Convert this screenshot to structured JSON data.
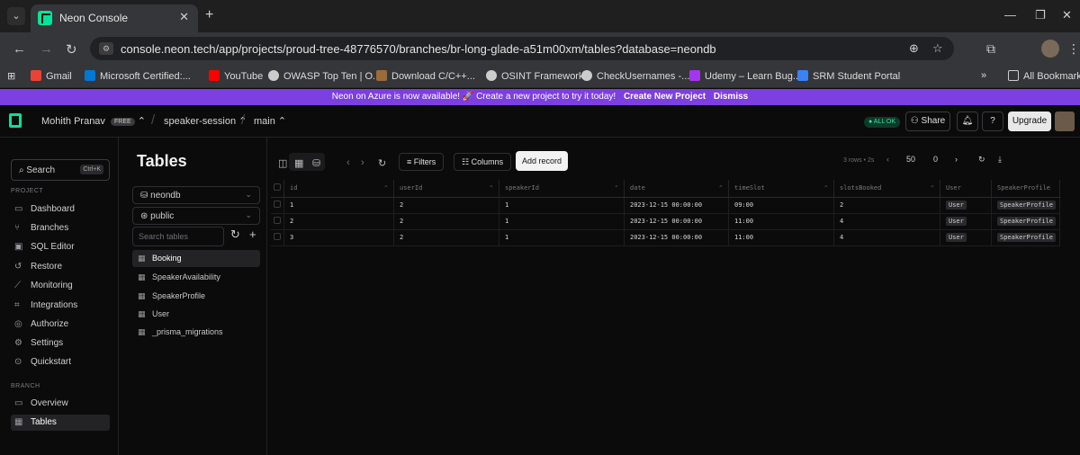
{
  "browser": {
    "tab_title": "Neon Console",
    "url": "console.neon.tech/app/projects/proud-tree-48776570/branches/br-long-glade-a51m00xm/tables?database=neondb",
    "bookmarks": [
      {
        "label": "Gmail",
        "color": "#ea4335"
      },
      {
        "label": "Microsoft Certified:...",
        "color": "#0078d4"
      },
      {
        "label": "YouTube",
        "color": "#ff0000"
      },
      {
        "label": "OWASP Top Ten | O...",
        "color": "#cccccc"
      },
      {
        "label": "Download C/C++...",
        "color": "#9b6b3a"
      },
      {
        "label": "OSINT Framework",
        "color": "#cccccc"
      },
      {
        "label": "CheckUsernames -...",
        "color": "#cccccc"
      },
      {
        "label": "Udemy – Learn Bug...",
        "color": "#a435f0"
      },
      {
        "label": "SRM Student Portal",
        "color": "#3b82f6"
      }
    ],
    "all_bookmarks": "All Bookmarks",
    "more_bookmarks": "»"
  },
  "banner": {
    "text": "Neon on Azure is now available! 🚀 Create a new project to try it today!",
    "cta": "Create New Project",
    "dismiss": "Dismiss"
  },
  "header": {
    "user": "Mohith Pranav",
    "plan_badge": "FREE",
    "project": "speaker-session",
    "branch": "main",
    "status": "● ALL OK",
    "share": "Share",
    "upgrade": "Upgrade"
  },
  "sidebar": {
    "search_label": "Search",
    "search_shortcut": "Ctrl+K",
    "project_heading": "PROJECT",
    "project_items": [
      {
        "label": "Dashboard",
        "icon": "▭"
      },
      {
        "label": "Branches",
        "icon": "⑂"
      },
      {
        "label": "SQL Editor",
        "icon": "▣"
      },
      {
        "label": "Restore",
        "icon": "↺"
      },
      {
        "label": "Monitoring",
        "icon": "⟋"
      },
      {
        "label": "Integrations",
        "icon": "⌗"
      },
      {
        "label": "Authorize",
        "icon": "◎"
      },
      {
        "label": "Settings",
        "icon": "⚙"
      },
      {
        "label": "Quickstart",
        "icon": "⊙"
      }
    ],
    "branch_heading": "BRANCH",
    "branch_items": [
      {
        "label": "Overview",
        "icon": "▭"
      },
      {
        "label": "Tables",
        "icon": "▦"
      }
    ]
  },
  "tables_panel": {
    "title": "Tables",
    "database": "neondb",
    "schema": "public",
    "search_placeholder": "Search tables",
    "tables": [
      "Booking",
      "SpeakerAvailability",
      "SpeakerProfile",
      "User",
      "_prisma_migrations"
    ]
  },
  "toolbar": {
    "filters": "Filters",
    "columns": "Columns",
    "add_record": "Add record",
    "rows_info": "3 rows • 2s",
    "page_size": "50",
    "page": "0"
  },
  "grid": {
    "columns": [
      "id",
      "userId",
      "speakerId",
      "date",
      "timeSlot",
      "slotsBooked",
      "User",
      "SpeakerProfile"
    ],
    "rows": [
      [
        "1",
        "2",
        "1",
        "2023-12-15 00:00:00",
        "09:00",
        "2",
        "User",
        "SpeakerProfile"
      ],
      [
        "2",
        "2",
        "1",
        "2023-12-15 00:00:00",
        "11:00",
        "4",
        "User",
        "SpeakerProfile"
      ],
      [
        "3",
        "2",
        "1",
        "2023-12-15 00:00:00",
        "11:00",
        "4",
        "User",
        "SpeakerProfile"
      ]
    ]
  },
  "colors": {
    "brand": "#00e599",
    "banner": "#7c3fe0",
    "background": "#0b0b0c"
  }
}
